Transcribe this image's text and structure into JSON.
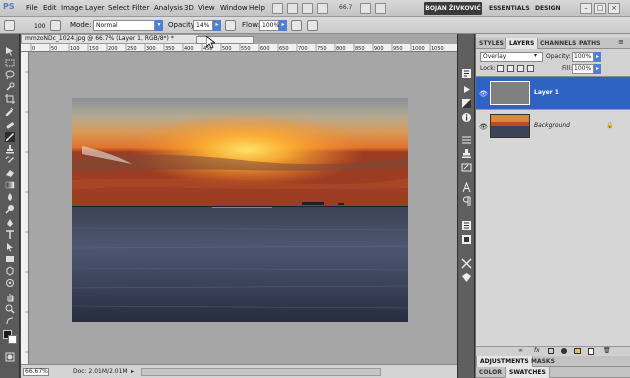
{
  "app": {
    "logo": "PS",
    "menu": [
      "File",
      "Edit",
      "Image",
      "Layer",
      "Select",
      "Filter",
      "Analysis",
      "3D",
      "View",
      "Window",
      "Help"
    ],
    "zoom_display": "66.7",
    "workspace_user": "BOJAN ŽIVKOVIĆ",
    "workspaces": [
      "ESSENTIALS",
      "DESIGN"
    ],
    "window_buttons": [
      "–",
      "□",
      "×"
    ]
  },
  "options": {
    "brush_size": "100",
    "mode_label": "Mode:",
    "mode_value": "Normal",
    "opacity_label": "Opacity:",
    "opacity_value": "14%",
    "flow_label": "Flow:",
    "flow_value": "100%"
  },
  "document": {
    "tab_title": "mmzoNDc_1024.jpg @ 66.7% (Layer 1, RGB/8*) *",
    "ruler_ticks": [
      "0",
      "50",
      "100",
      "150",
      "200",
      "250",
      "300",
      "350",
      "400",
      "450",
      "500",
      "550",
      "600",
      "650",
      "700",
      "750",
      "800",
      "850",
      "900",
      "950",
      "1000",
      "1050"
    ],
    "zoom": "66.67%",
    "doc_size": "Doc: 2.01M/2.01M"
  },
  "panel": {
    "top_tabs": [
      "STYLES",
      "LAYERS",
      "CHANNELS",
      "PATHS"
    ],
    "blend_mode": "Overlay",
    "opacity_label": "Opacity:",
    "opacity_value": "100%",
    "lock_label": "Lock:",
    "fill_label": "Fill:",
    "fill_value": "100%",
    "layers": [
      {
        "name": "Layer 1",
        "selected": true
      },
      {
        "name": "Background",
        "selected": false
      }
    ],
    "bottom_tabs_1": [
      "ADJUSTMENTS",
      "MASKS"
    ],
    "bottom_tabs_2": [
      "COLOR",
      "SWATCHES"
    ]
  },
  "colors": {
    "selection_blue": "#2e63c4",
    "accent_blue": "#4f7fd3"
  }
}
